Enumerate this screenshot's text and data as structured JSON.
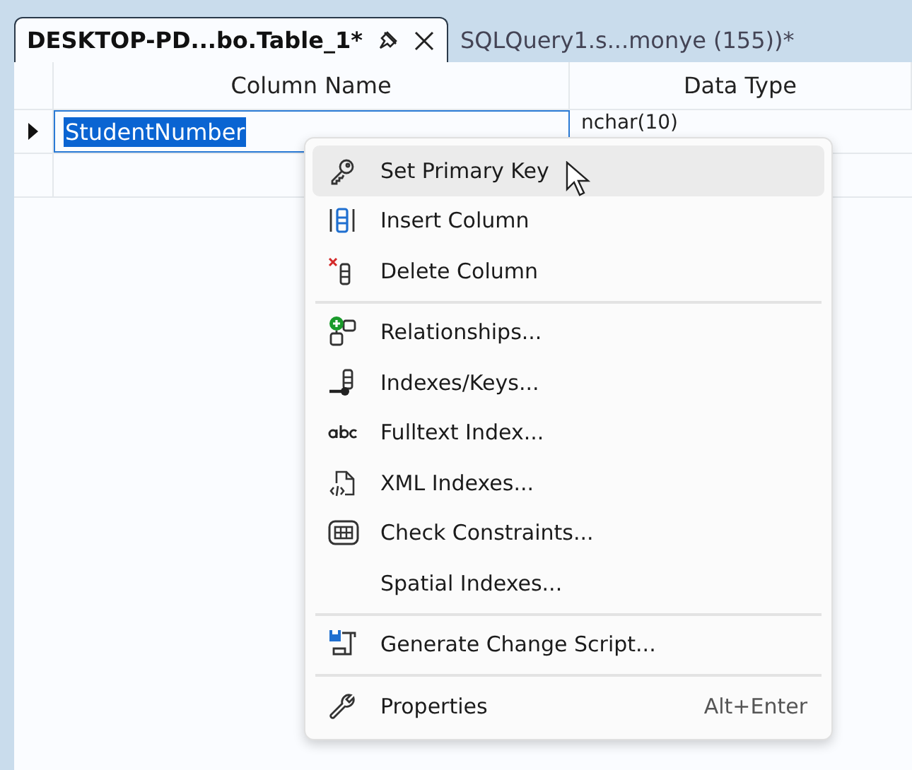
{
  "tabs": [
    {
      "label": "DESKTOP-PD...bo.Table_1*",
      "selected": true
    },
    {
      "label": "SQLQuery1.s...monye (155))*",
      "selected": false
    }
  ],
  "grid": {
    "columns": [
      "Column Name",
      "Data Type"
    ],
    "rows": [
      {
        "selected": true,
        "cells": [
          "StudentNumber",
          "nchar(10)"
        ]
      }
    ]
  },
  "context_menu": {
    "groups": [
      [
        {
          "label": "Set Primary Key",
          "selected": true
        },
        {
          "label": "Insert Column",
          "selected": false
        },
        {
          "label": "Delete Column",
          "selected": false
        }
      ],
      [
        {
          "label": "Relationships...",
          "selected": false
        },
        {
          "label": "Indexes/Keys...",
          "selected": false
        },
        {
          "label": "Fulltext Index...",
          "selected": false
        },
        {
          "label": "XML Indexes...",
          "selected": false
        },
        {
          "label": "Check Constraints...",
          "selected": false
        },
        {
          "label": "Spatial Indexes...",
          "selected": false
        }
      ],
      [
        {
          "label": "Generate Change Script...",
          "selected": false
        }
      ],
      [
        {
          "label": "Properties",
          "shortcut": "Alt+Enter",
          "selected": false
        }
      ]
    ]
  }
}
